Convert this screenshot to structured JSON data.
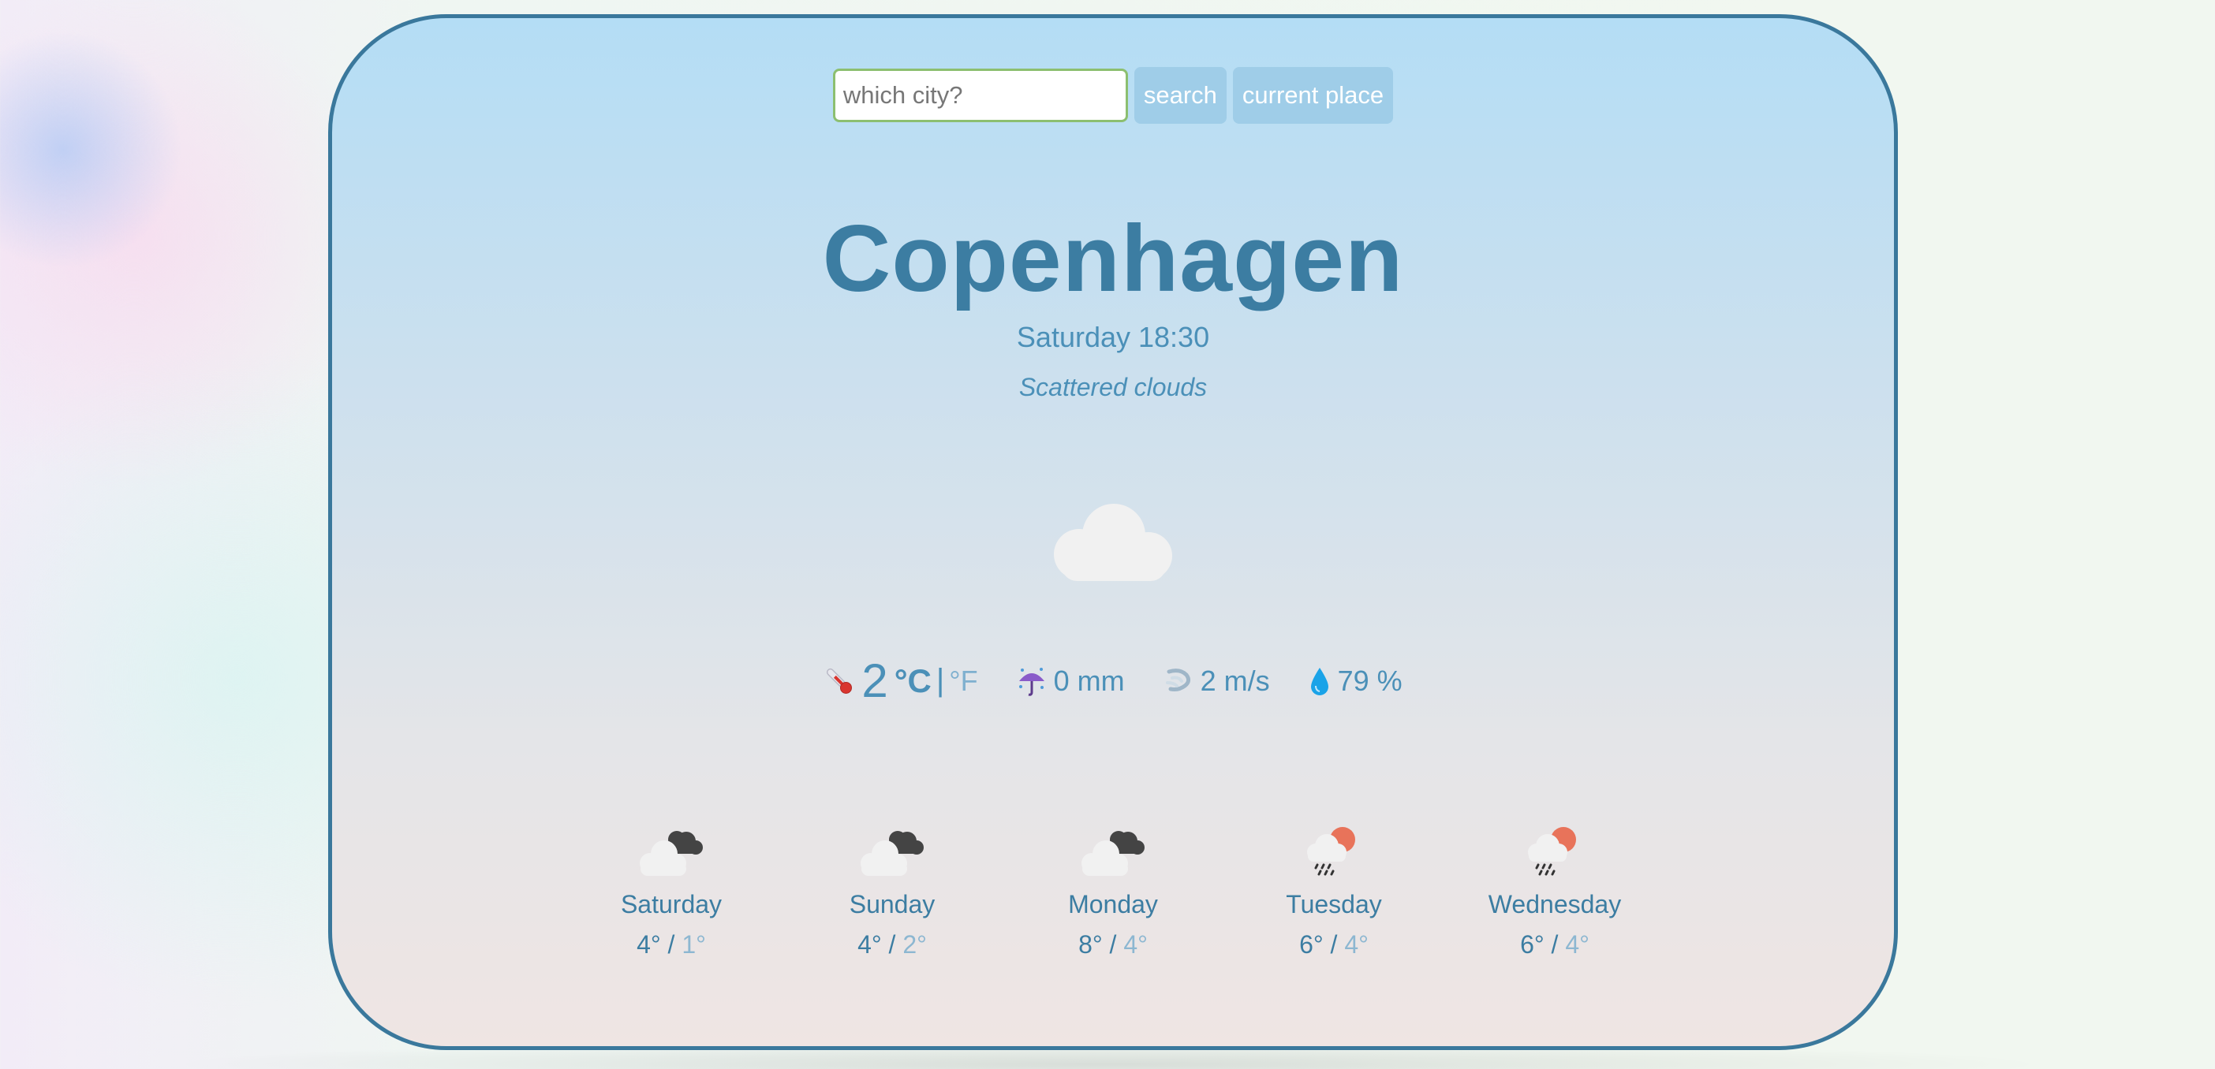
{
  "search": {
    "placeholder": "which city?",
    "value": "",
    "search_label": "search",
    "current_label": "current place"
  },
  "current": {
    "city": "Copenhagen",
    "datetime": "Saturday 18:30",
    "description": "Scattered clouds",
    "icon": "cloud-icon",
    "temperature": "2",
    "unit_c": "°C",
    "unit_sep": "|",
    "unit_f": "°F",
    "precipitation": "0 mm",
    "wind": "2 m/s",
    "humidity": "79 %"
  },
  "forecast": [
    {
      "day": "Saturday",
      "max": "4°",
      "min": "1°",
      "icon": "partly-cloudy-night-icon"
    },
    {
      "day": "Sunday",
      "max": "4°",
      "min": "2°",
      "icon": "partly-cloudy-night-icon"
    },
    {
      "day": "Monday",
      "max": "8°",
      "min": "4°",
      "icon": "partly-cloudy-night-icon"
    },
    {
      "day": "Tuesday",
      "max": "6°",
      "min": "4°",
      "icon": "rain-sun-icon"
    },
    {
      "day": "Wednesday",
      "max": "6°",
      "min": "4°",
      "icon": "rain-sun-icon"
    }
  ],
  "colors": {
    "border": "#3a789c",
    "primary_text": "#3c7da2",
    "secondary_text": "#4b90b8",
    "button_bg": "#9fcde8",
    "input_border": "#8cbf70"
  }
}
